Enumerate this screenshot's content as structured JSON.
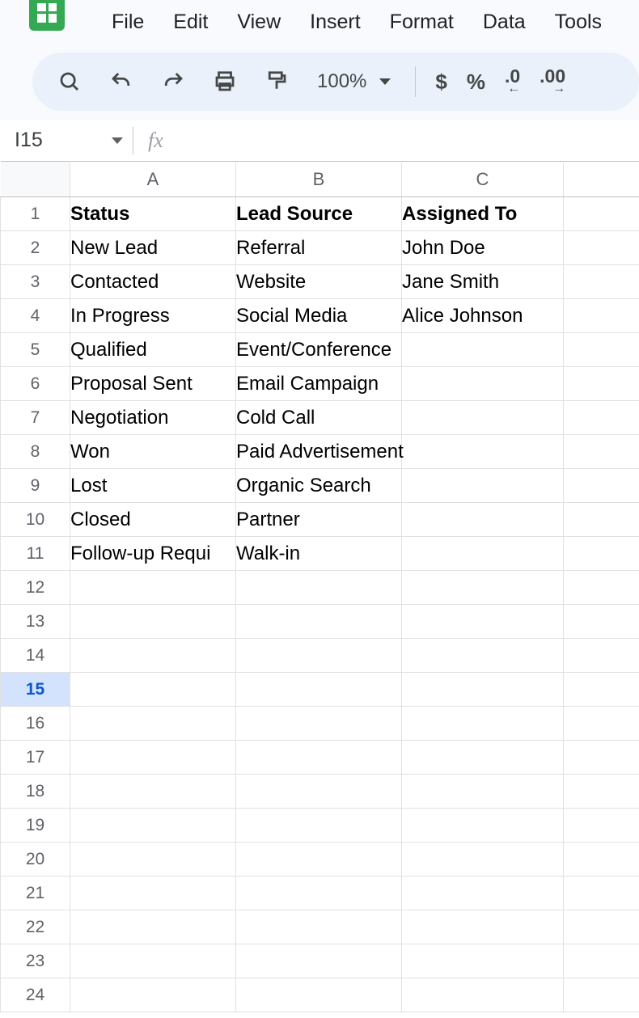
{
  "menus": [
    "File",
    "Edit",
    "View",
    "Insert",
    "Format",
    "Data",
    "Tools"
  ],
  "toolbar": {
    "zoom": "100%",
    "currency": "$",
    "percent": "%",
    "decDecrease": ".0",
    "decIncrease": ".00"
  },
  "formulaBar": {
    "nameBox": "I15",
    "fx": "fx"
  },
  "columns": [
    "A",
    "B",
    "C"
  ],
  "activeRow": 15,
  "rows": [
    {
      "n": 1,
      "bold": true,
      "A": "Status",
      "B": "Lead Source",
      "C": "Assigned To"
    },
    {
      "n": 2,
      "bold": false,
      "A": "New Lead",
      "B": "Referral",
      "C": "John Doe"
    },
    {
      "n": 3,
      "bold": false,
      "A": "Contacted",
      "B": "Website",
      "C": "Jane Smith"
    },
    {
      "n": 4,
      "bold": false,
      "A": "In Progress",
      "B": "Social Media",
      "C": "Alice Johnson"
    },
    {
      "n": 5,
      "bold": false,
      "A": "Qualified",
      "B": "Event/Conference",
      "C": "",
      "Boverflow": true
    },
    {
      "n": 6,
      "bold": false,
      "A": "Proposal Sent",
      "B": "Email Campaign",
      "C": ""
    },
    {
      "n": 7,
      "bold": false,
      "A": "Negotiation",
      "B": "Cold Call",
      "C": ""
    },
    {
      "n": 8,
      "bold": false,
      "A": "Won",
      "B": "Paid Advertisement",
      "C": "",
      "Boverflow": true
    },
    {
      "n": 9,
      "bold": false,
      "A": "Lost",
      "B": "Organic Search",
      "C": ""
    },
    {
      "n": 10,
      "bold": false,
      "A": "Closed",
      "B": "Partner",
      "C": ""
    },
    {
      "n": 11,
      "bold": false,
      "A": "Follow-up Requi",
      "B": "Walk-in",
      "C": ""
    },
    {
      "n": 12,
      "bold": false,
      "A": "",
      "B": "",
      "C": ""
    },
    {
      "n": 13,
      "bold": false,
      "A": "",
      "B": "",
      "C": ""
    },
    {
      "n": 14,
      "bold": false,
      "A": "",
      "B": "",
      "C": ""
    },
    {
      "n": 15,
      "bold": false,
      "A": "",
      "B": "",
      "C": ""
    },
    {
      "n": 16,
      "bold": false,
      "A": "",
      "B": "",
      "C": ""
    },
    {
      "n": 17,
      "bold": false,
      "A": "",
      "B": "",
      "C": ""
    },
    {
      "n": 18,
      "bold": false,
      "A": "",
      "B": "",
      "C": ""
    },
    {
      "n": 19,
      "bold": false,
      "A": "",
      "B": "",
      "C": ""
    },
    {
      "n": 20,
      "bold": false,
      "A": "",
      "B": "",
      "C": ""
    },
    {
      "n": 21,
      "bold": false,
      "A": "",
      "B": "",
      "C": ""
    },
    {
      "n": 22,
      "bold": false,
      "A": "",
      "B": "",
      "C": ""
    },
    {
      "n": 23,
      "bold": false,
      "A": "",
      "B": "",
      "C": ""
    },
    {
      "n": 24,
      "bold": false,
      "A": "",
      "B": "",
      "C": ""
    }
  ]
}
